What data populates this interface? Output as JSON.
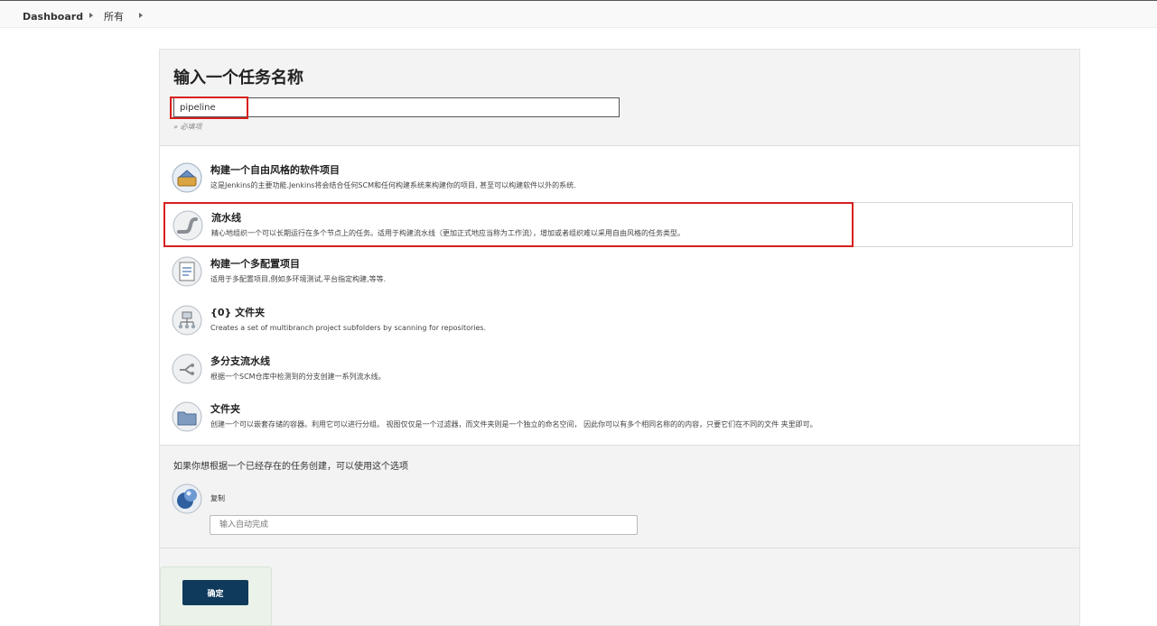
{
  "breadcrumb": {
    "dashboard": "Dashboard",
    "all": "所有"
  },
  "form": {
    "title": "输入一个任务名称",
    "name_value": "pipeline",
    "required_note": "» 必填项"
  },
  "item_types": [
    {
      "name": "构建一个自由风格的软件项目",
      "desc": "这是Jenkins的主要功能.Jenkins将会结合任何SCM和任何构建系统来构建你的项目, 甚至可以构建软件以外的系统.",
      "icon": "freestyle-project-icon"
    },
    {
      "name": "流水线",
      "desc": "精心地组织一个可以长期运行在多个节点上的任务。适用于构建流水线（更加正式地应当称为工作流），增加或者组织难以采用自由风格的任务类型。",
      "icon": "pipeline-icon"
    },
    {
      "name": "构建一个多配置项目",
      "desc": "适用于多配置项目,例如多环境测试,平台指定构建,等等.",
      "icon": "multi-config-icon"
    },
    {
      "name": "{0} 文件夹",
      "desc": "Creates a set of multibranch project subfolders by scanning for repositories.",
      "icon": "organization-folder-icon"
    },
    {
      "name": "多分支流水线",
      "desc": "根据一个SCM仓库中检测到的分支创建一系列流水线。",
      "icon": "multibranch-pipeline-icon"
    },
    {
      "name": "文件夹",
      "desc": "创建一个可以嵌套存储的容器。利用它可以进行分组。 视图仅仅是一个过滤器，而文件夹则是一个独立的命名空间， 因此你可以有多个相同名称的的内容，只要它们在不同的文件 夹里即可。",
      "icon": "folder-icon"
    }
  ],
  "copy": {
    "caption": "如果你想根据一个已经存在的任务创建，可以使用这个选项",
    "label": "复制",
    "placeholder": "输入自动完成"
  },
  "ok_label": "确定",
  "colors": {
    "highlight": "#d91e1e",
    "button": "#0f3a5c"
  }
}
